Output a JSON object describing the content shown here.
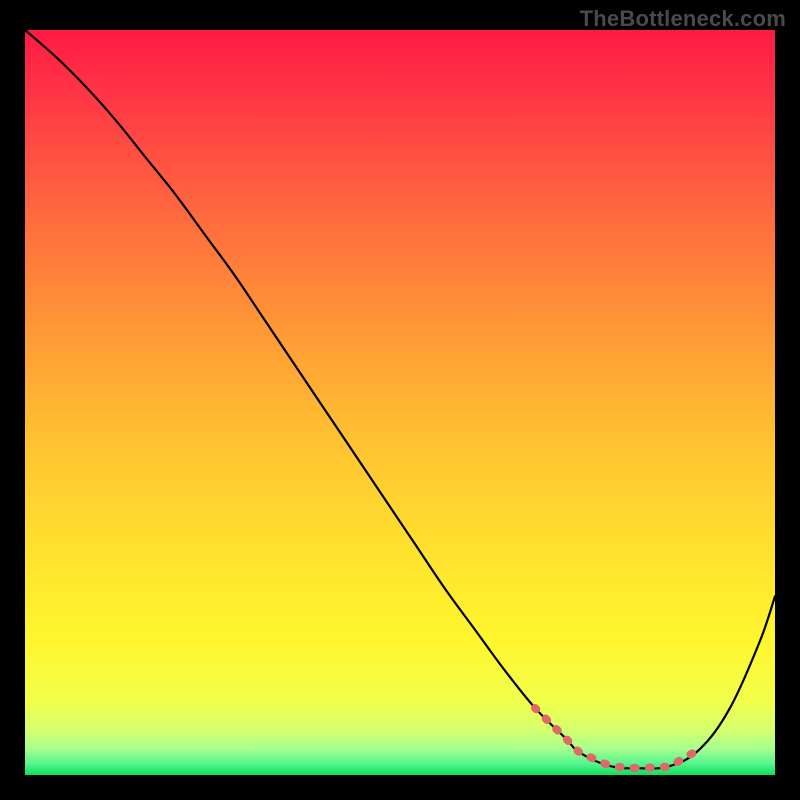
{
  "attribution": "TheBottleneck.com",
  "colors": {
    "gradient_stops": [
      {
        "offset": 0.0,
        "color": "#ff1a44"
      },
      {
        "offset": 0.1,
        "color": "#ff3a45"
      },
      {
        "offset": 0.25,
        "color": "#ff6a3e"
      },
      {
        "offset": 0.4,
        "color": "#ff9836"
      },
      {
        "offset": 0.55,
        "color": "#ffc231"
      },
      {
        "offset": 0.7,
        "color": "#ffe22e"
      },
      {
        "offset": 0.82,
        "color": "#fff62e"
      },
      {
        "offset": 0.9,
        "color": "#f2ff4a"
      },
      {
        "offset": 0.94,
        "color": "#d4ff6e"
      },
      {
        "offset": 0.965,
        "color": "#a6ff8e"
      },
      {
        "offset": 0.985,
        "color": "#55f58e"
      },
      {
        "offset": 1.0,
        "color": "#0be05a"
      }
    ],
    "curve": "#000000",
    "marker": "#e06868",
    "background": "#000000"
  },
  "chart_data": {
    "type": "line",
    "title": "",
    "xlabel": "",
    "ylabel": "",
    "xlim": [
      0,
      100
    ],
    "ylim": [
      0,
      100
    ],
    "series": [
      {
        "name": "bottleneck-curve",
        "x": [
          0,
          4,
          8,
          12,
          16,
          20,
          24,
          28,
          32,
          36,
          40,
          44,
          48,
          52,
          56,
          60,
          64,
          68,
          72,
          74,
          78,
          82,
          86,
          90,
          94,
          98,
          100
        ],
        "y": [
          100,
          96.5,
          92.5,
          88,
          83,
          78,
          72.5,
          67,
          61,
          55,
          49,
          43,
          37,
          31,
          25,
          19.5,
          14,
          9,
          5,
          3,
          1.2,
          0.9,
          1.2,
          3.5,
          9,
          18,
          24
        ]
      }
    ],
    "annotations": [
      {
        "name": "optimal-range-marker",
        "x_start": 68,
        "x_end": 90
      }
    ]
  }
}
